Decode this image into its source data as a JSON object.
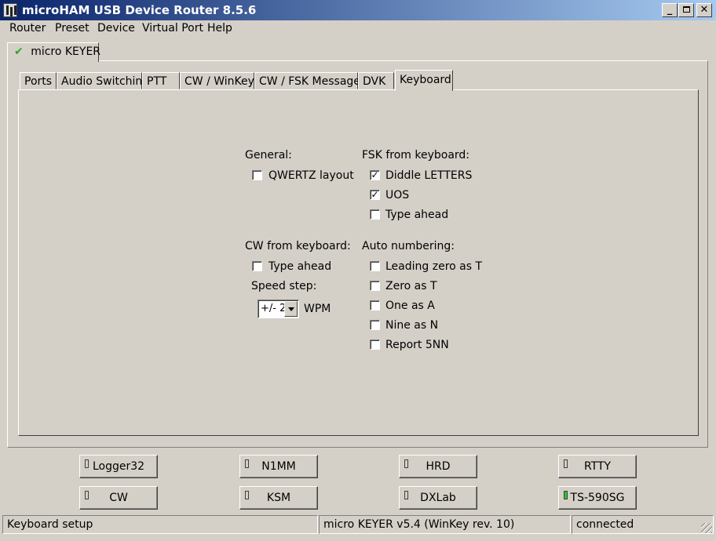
{
  "window": {
    "title": "microHAM USB Device Router 8.5.6"
  },
  "menu": [
    "Router",
    "Preset",
    "Device",
    "Virtual Port",
    "Help"
  ],
  "device_tab": {
    "label": "micro KEYER"
  },
  "tabs": [
    "Ports",
    "Audio Switching",
    "PTT",
    "CW / WinKey",
    "CW / FSK Messages",
    "DVK",
    "Keyboard"
  ],
  "active_tab": "Keyboard",
  "keyboard": {
    "general": {
      "heading": "General:",
      "qwertz_label": "QWERTZ layout",
      "qwertz_checked": false
    },
    "fsk": {
      "heading": "FSK from keyboard:",
      "items": [
        {
          "label": "Diddle LETTERS",
          "checked": true
        },
        {
          "label": "UOS",
          "checked": true
        },
        {
          "label": "Type ahead",
          "checked": false
        }
      ]
    },
    "cw": {
      "heading": "CW from keyboard:",
      "type_ahead_label": "Type ahead",
      "type_ahead_checked": false,
      "speed_step_label": "Speed step:",
      "speed_step_value": "+/- 2",
      "wpm_label": "WPM"
    },
    "autonum": {
      "heading": "Auto numbering:",
      "items": [
        {
          "label": "Leading zero as T",
          "checked": false
        },
        {
          "label": "Zero as T",
          "checked": false
        },
        {
          "label": "One as A",
          "checked": false
        },
        {
          "label": "Nine as N",
          "checked": false
        },
        {
          "label": "Report 5NN",
          "checked": false
        }
      ]
    }
  },
  "preset_buttons": [
    {
      "label": "Logger32",
      "led_on": false
    },
    {
      "label": "N1MM",
      "led_on": false
    },
    {
      "label": "HRD",
      "led_on": false
    },
    {
      "label": "RTTY",
      "led_on": false
    },
    {
      "label": "CW",
      "led_on": false
    },
    {
      "label": "KSM",
      "led_on": false
    },
    {
      "label": "DXLab",
      "led_on": false
    },
    {
      "label": "TS-590SG",
      "led_on": true
    }
  ],
  "status": {
    "left": "Keyboard setup",
    "middle": "micro KEYER v5.4 (WinKey rev. 10)",
    "right": "connected"
  },
  "colors": {
    "title_start": "#0a246a",
    "title_end": "#a6caf0",
    "face": "#d4d0c8",
    "led_on": "#22cc22"
  }
}
